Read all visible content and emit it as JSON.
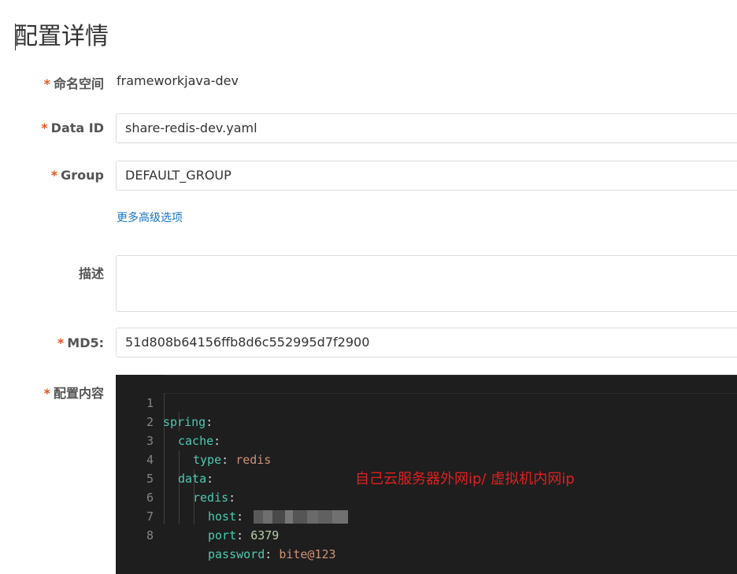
{
  "page_title": "配置详情",
  "required_mark": "*",
  "fields": {
    "namespace": {
      "label": "命名空间",
      "value": "frameworkjava-dev"
    },
    "data_id": {
      "label": "Data ID",
      "value": "share-redis-dev.yaml"
    },
    "group": {
      "label": "Group",
      "value": "DEFAULT_GROUP"
    },
    "more_options_link": "更多高级选项",
    "description": {
      "label": "描述",
      "value": ""
    },
    "md5": {
      "label": "MD5:",
      "value": "51d808b64156ffb8d6c552995d7f2900"
    },
    "content": {
      "label": "配置内容"
    }
  },
  "editor": {
    "line_numbers": [
      "1",
      "2",
      "3",
      "4",
      "5",
      "6",
      "7",
      "8"
    ],
    "lines": [
      {
        "key": "spring",
        "sep": ":",
        "value": ""
      },
      {
        "key": "cache",
        "sep": ":",
        "value": ""
      },
      {
        "key": "type",
        "sep": ": ",
        "value": "redis"
      },
      {
        "key": "data",
        "sep": ":",
        "value": ""
      },
      {
        "key": "redis",
        "sep": ":",
        "value": ""
      },
      {
        "key": "host",
        "sep": ": ",
        "value": ""
      },
      {
        "key": "port",
        "sep": ": ",
        "value": "6379"
      },
      {
        "key": "password",
        "sep": ": ",
        "value": "bite@123"
      }
    ]
  },
  "annotation": "自己云服务器外网ip/ 虚拟机内网ip",
  "colors": {
    "required": "#e8541e",
    "link": "#1a73c8",
    "editor_bg": "#1e1e1e",
    "yaml_key": "#4ec9b0",
    "yaml_string": "#ce9178",
    "yaml_number": "#b5cea8",
    "annotation": "#e02020"
  }
}
